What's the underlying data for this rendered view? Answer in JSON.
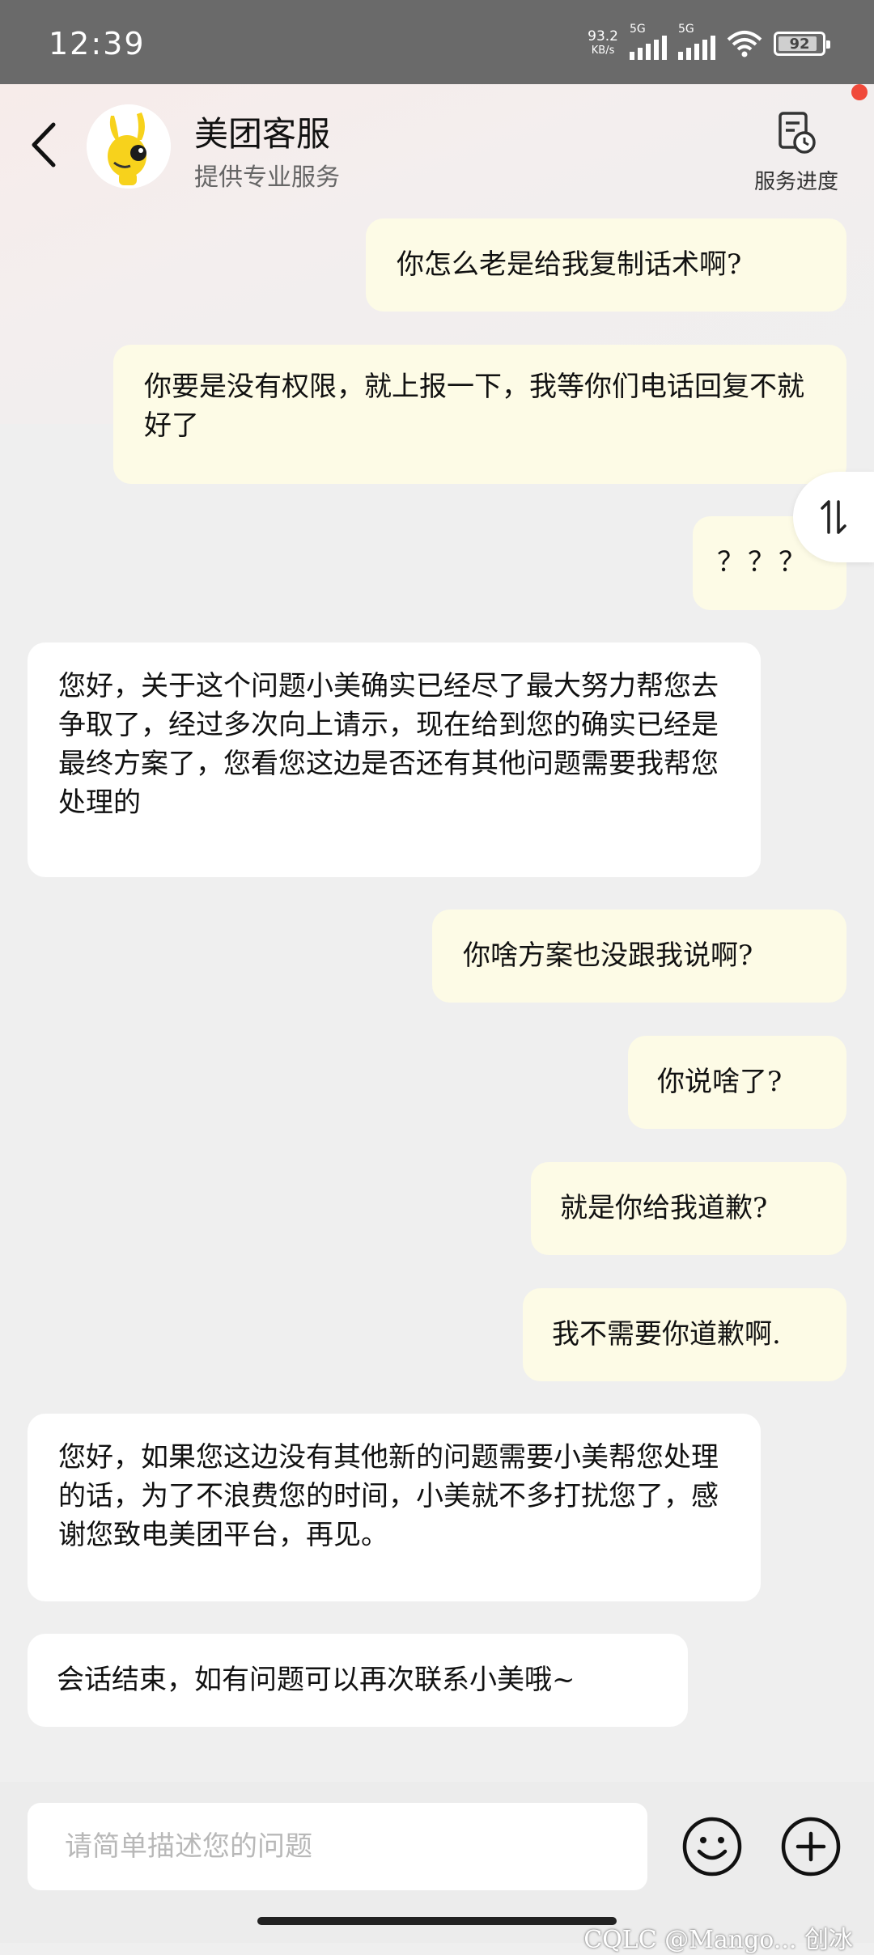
{
  "status_bar": {
    "time": "12:39",
    "net_speed_value": "93.2",
    "net_speed_unit": "KB/s",
    "signal1_label": "5G",
    "signal2_label": "5G",
    "battery": "92"
  },
  "header": {
    "title": "美团客服",
    "subtitle": "提供专业服务",
    "progress_label": "服务进度"
  },
  "messages": [
    {
      "from": "user",
      "text": "你怎么老是给我复制话术啊?"
    },
    {
      "from": "user",
      "text": "你要是没有权限，就上报一下，我等你们电话回复不就好了"
    },
    {
      "from": "user",
      "text": "？？？"
    },
    {
      "from": "agent",
      "text": "您好，关于这个问题小美确实已经尽了最大努力帮您去争取了，经过多次向上请示，现在给到您的确实已经是最终方案了，您看您这边是否还有其他问题需要我帮您处理的"
    },
    {
      "from": "user",
      "text": "你啥方案也没跟我说啊?"
    },
    {
      "from": "user",
      "text": "你说啥了?"
    },
    {
      "from": "user",
      "text": "就是你给我道歉?"
    },
    {
      "from": "user",
      "text": "我不需要你道歉啊."
    },
    {
      "from": "agent",
      "text": "您好，如果您这边没有其他新的问题需要小美帮您处理的话，为了不浪费您的时间，小美就不多打扰您了，感谢您致电美团平台，再见。"
    },
    {
      "from": "agent",
      "text": "会话结束，如有问题可以再次联系小美哦~"
    }
  ],
  "input": {
    "placeholder": "请简单描述您的问题"
  },
  "watermark": "CQLC @Mango... 创冰",
  "colors": {
    "user_bubble": "#fdfbe6",
    "agent_bubble": "#ffffff",
    "background": "#efefef",
    "status_bar": "#6a6a6a",
    "badge": "#f0493a",
    "avatar_yellow": "#f7d21c"
  },
  "icons": {
    "back": "chevron-left-icon",
    "progress": "document-clock-icon",
    "scroll": "swap-vertical-icon",
    "emoji": "smiley-icon",
    "more": "plus-circle-icon"
  }
}
